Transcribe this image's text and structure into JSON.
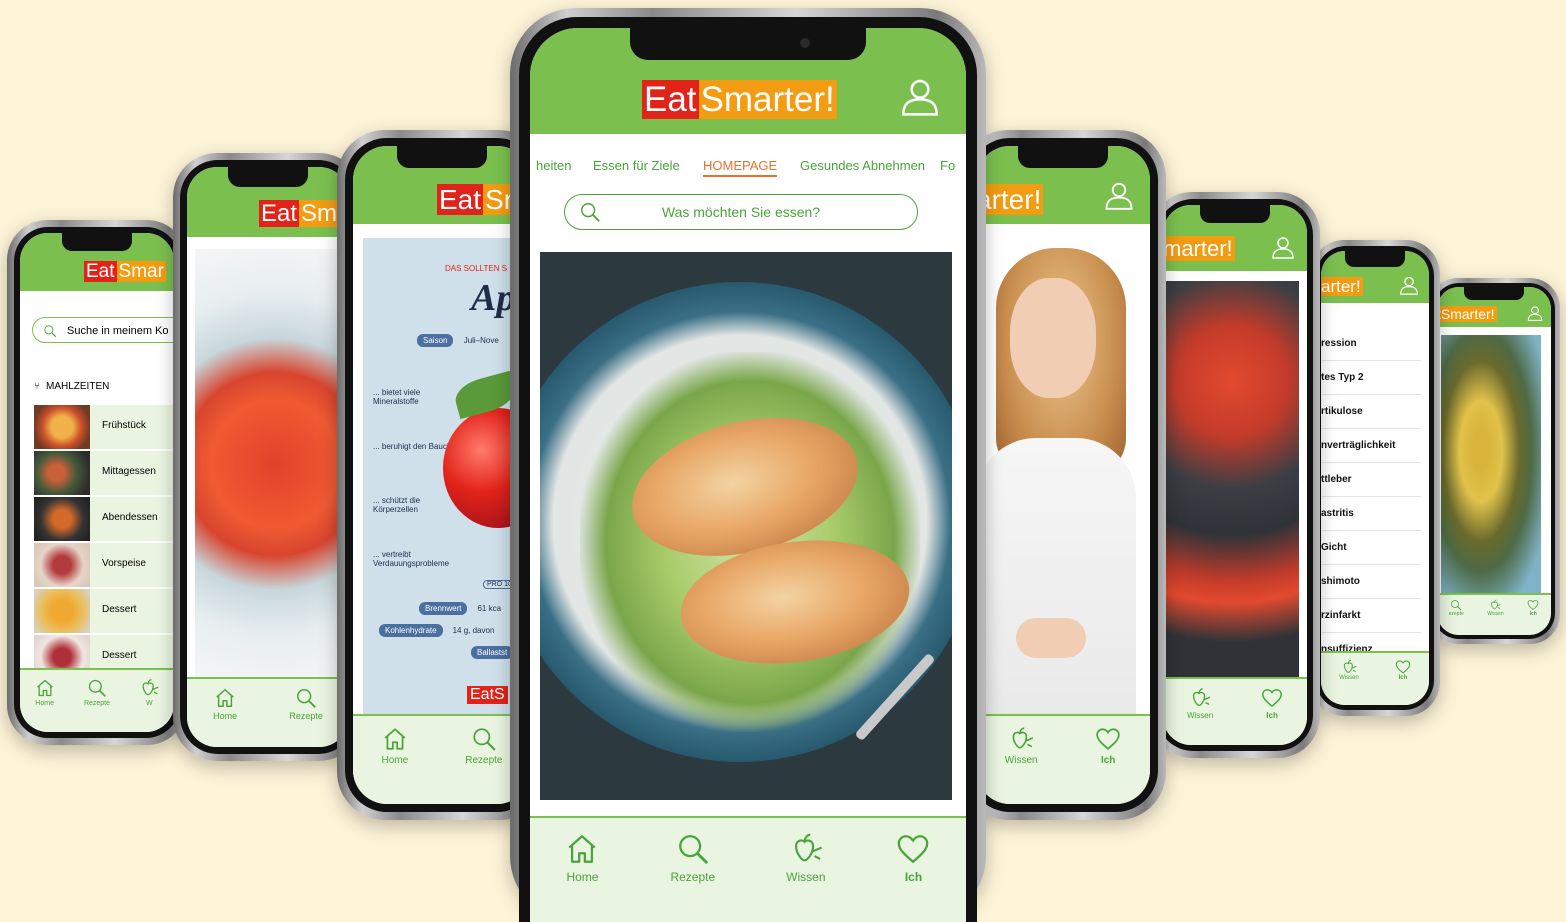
{
  "colors": {
    "background": "#fdf3d7",
    "brand_green": "#7bc04f",
    "nav_green": "#4aa43b",
    "logo_red": "#e2231a",
    "logo_orange": "#f39c12",
    "active_tab": "#e8702a"
  },
  "logo": {
    "eat": "Eat",
    "smarter": "Smarter!"
  },
  "main": {
    "tabs": [
      "heiten",
      "Essen für Ziele",
      "HOMEPAGE",
      "Gesundes Abnehmen",
      "Fo"
    ],
    "active_tab": "HOMEPAGE",
    "search_placeholder": "Was möchten Sie essen?",
    "nav": [
      {
        "label": "Home",
        "icon": "home-icon"
      },
      {
        "label": "Rezepte",
        "icon": "search-icon"
      },
      {
        "label": "Wissen",
        "icon": "vegetables-icon"
      },
      {
        "label": "Ich",
        "icon": "heart-icon"
      }
    ]
  },
  "left1": {
    "logo_partial": {
      "eat": "Eat",
      "smarter": "Smar"
    },
    "search_placeholder": "Suche in meinem Ko",
    "section_title": "MAHLZEITEN",
    "meals": [
      "Frühstück",
      "Mittagessen",
      "Abendessen",
      "Vorspeise",
      "Dessert",
      "Dessert"
    ],
    "nav": [
      {
        "label": "Home",
        "icon": "home-icon"
      },
      {
        "label": "Rezepte",
        "icon": "search-icon"
      },
      {
        "label": "W",
        "icon": "vegetables-icon"
      }
    ]
  },
  "left2": {
    "logo_partial": {
      "eat": "Eat",
      "smarter": "Sm"
    },
    "nav": [
      {
        "label": "Home",
        "icon": "home-icon"
      },
      {
        "label": "Rezepte",
        "icon": "search-icon"
      }
    ]
  },
  "left3": {
    "logo_partial": {
      "eat": "Eat",
      "smarter": "Sr"
    },
    "infographic": {
      "kicker": "DAS SOLLTEN S",
      "title": "Ap",
      "season_label": "Saison",
      "season_value": "Juli–Nove",
      "benefits": [
        "... bietet viele Mineralstoffe",
        "... beruhigt den Bauch",
        "... schützt die Körperzellen",
        "... vertreibt Verdauungsprobleme"
      ],
      "per100": "PRO 10",
      "nutrients": [
        {
          "label": "Brennwert",
          "value": "61 kca"
        },
        {
          "label": "Kohlenhydrate",
          "value": "14 g, davon"
        },
        {
          "label": "Ballastst",
          "value": ""
        }
      ],
      "footer_logo": "EatS"
    },
    "nav": [
      {
        "label": "Home",
        "icon": "home-icon"
      },
      {
        "label": "Rezepte",
        "icon": "search-icon"
      }
    ]
  },
  "right1": {
    "logo_partial": "arter!",
    "nav": [
      {
        "label": "Wissen",
        "icon": "vegetables-icon"
      },
      {
        "label": "Ich",
        "icon": "heart-icon"
      }
    ]
  },
  "right2": {
    "logo_partial": "marter!",
    "nav": [
      {
        "label": "Wissen",
        "icon": "vegetables-icon"
      },
      {
        "label": "Ich",
        "icon": "heart-icon"
      }
    ]
  },
  "right3": {
    "logo_partial": "arter!",
    "topics": [
      "ression",
      "tes Typ 2",
      "rtikulose",
      "nverträglichkeit",
      "ttleber",
      "astritis",
      "Gicht",
      "shimoto",
      "rzinfarkt",
      "nsuffizienz"
    ],
    "nav": [
      {
        "label": "Wissen",
        "icon": "vegetables-icon"
      },
      {
        "label": "Ich",
        "icon": "heart-icon"
      }
    ]
  },
  "right4": {
    "logo_partial": "tSmarter!",
    "nav": [
      {
        "label": "ezepte",
        "icon": "search-icon"
      },
      {
        "label": "Wissen",
        "icon": "vegetables-icon"
      },
      {
        "label": "Ich",
        "icon": "heart-icon"
      }
    ]
  }
}
